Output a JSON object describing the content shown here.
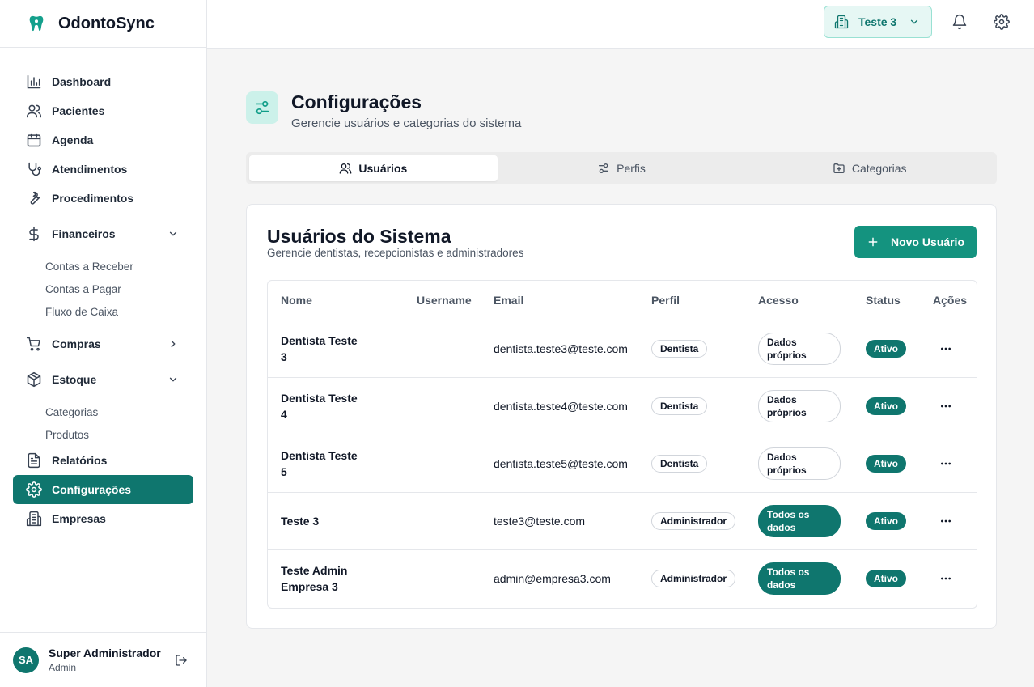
{
  "app": {
    "name": "OdontoSync"
  },
  "sidebar": {
    "items": [
      {
        "label": "Dashboard"
      },
      {
        "label": "Pacientes"
      },
      {
        "label": "Agenda"
      },
      {
        "label": "Atendimentos"
      },
      {
        "label": "Procedimentos"
      },
      {
        "label": "Financeiros",
        "sub": [
          "Contas a Receber",
          "Contas a Pagar",
          "Fluxo de Caixa"
        ]
      },
      {
        "label": "Compras"
      },
      {
        "label": "Estoque",
        "sub": [
          "Categorias",
          "Produtos"
        ]
      },
      {
        "label": "Relatórios"
      },
      {
        "label": "Configurações",
        "active": true
      },
      {
        "label": "Empresas"
      }
    ]
  },
  "user": {
    "initials": "SA",
    "name": "Super Administrador",
    "role": "Admin"
  },
  "topbar": {
    "company": "Teste 3"
  },
  "page": {
    "title": "Configurações",
    "subtitle": "Gerencie usuários e categorias do sistema"
  },
  "tabs": [
    {
      "label": "Usuários",
      "active": true
    },
    {
      "label": "Perfis"
    },
    {
      "label": "Categorias"
    }
  ],
  "card": {
    "title": "Usuários do Sistema",
    "subtitle": "Gerencie dentistas, recepcionistas e administradores",
    "new_button": "Novo Usuário"
  },
  "table": {
    "columns": [
      "Nome",
      "Username",
      "Email",
      "Perfil",
      "Acesso",
      "Status",
      "Ações"
    ],
    "rows": [
      {
        "name": "Dentista Teste 3",
        "username": "",
        "email": "dentista.teste3@teste.com",
        "profile": "Dentista",
        "access": "Dados próprios",
        "status": "Ativo"
      },
      {
        "name": "Dentista Teste 4",
        "username": "",
        "email": "dentista.teste4@teste.com",
        "profile": "Dentista",
        "access": "Dados próprios",
        "status": "Ativo"
      },
      {
        "name": "Dentista Teste 5",
        "username": "",
        "email": "dentista.teste5@teste.com",
        "profile": "Dentista",
        "access": "Dados próprios",
        "status": "Ativo"
      },
      {
        "name": "Teste 3",
        "username": "",
        "email": "teste3@teste.com",
        "profile": "Administrador",
        "access": "Todos os dados",
        "status": "Ativo"
      },
      {
        "name": "Teste Admin Empresa 3",
        "username": "",
        "email": "admin@empresa3.com",
        "profile": "Administrador",
        "access": "Todos os dados",
        "status": "Ativo"
      }
    ]
  },
  "colors": {
    "primary": "#0f766e",
    "button": "#14937f",
    "accent_light": "#e6f7f4"
  }
}
